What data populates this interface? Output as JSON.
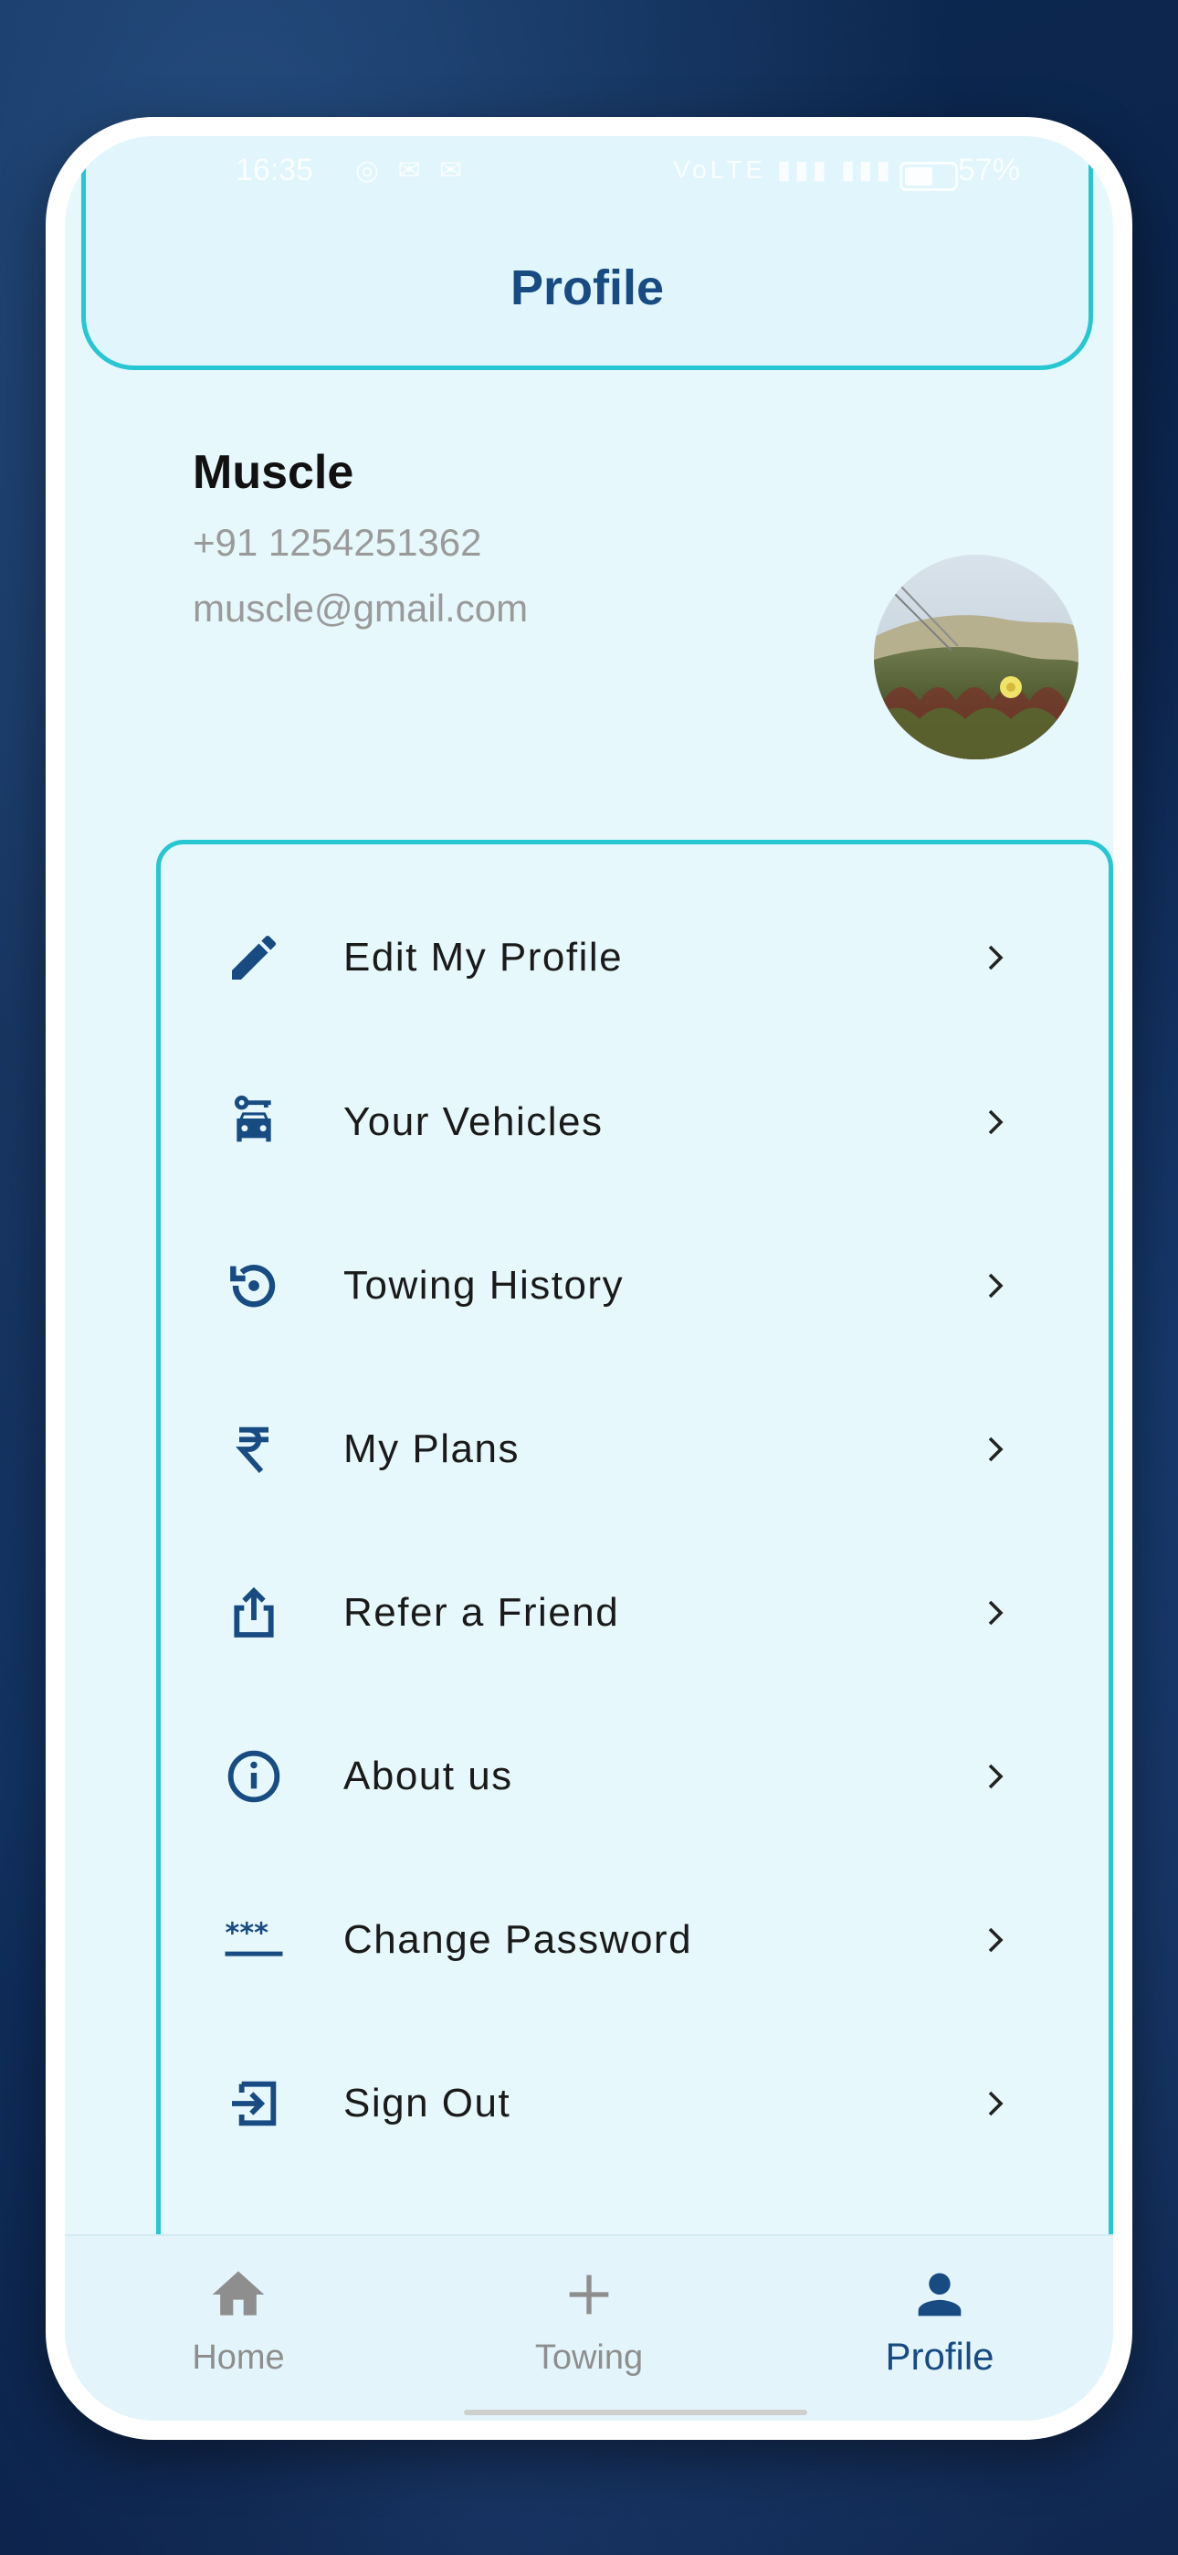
{
  "status_bar": {
    "time": "16:35",
    "left_icons": "◎ ✉ ✉",
    "right_icons": "VoLTE ▮▮▮ ▮▮▮",
    "battery_percent": "57%",
    "battery_level": 0.57
  },
  "header": {
    "title": "Profile"
  },
  "user": {
    "name": "Muscle",
    "phone": "+91 1254251362",
    "email": "muscle@gmail.com"
  },
  "menu": {
    "items": [
      {
        "label": "Edit My Profile",
        "icon": "edit-pencil-icon"
      },
      {
        "label": "Your Vehicles",
        "icon": "car-key-icon"
      },
      {
        "label": "Towing History",
        "icon": "history-icon"
      },
      {
        "label": "My Plans",
        "icon": "rupee-icon"
      },
      {
        "label": "Refer a Friend",
        "icon": "share-icon"
      },
      {
        "label": "About us",
        "icon": "info-icon"
      },
      {
        "label": "Change Password",
        "icon": "password-icon"
      },
      {
        "label": "Sign Out",
        "icon": "sign-out-icon"
      }
    ]
  },
  "bottom_nav": {
    "items": [
      {
        "label": "Home",
        "icon": "home-icon",
        "active": false
      },
      {
        "label": "Towing",
        "icon": "plus-icon",
        "active": false
      },
      {
        "label": "Profile",
        "icon": "person-icon",
        "active": true
      }
    ]
  },
  "colors": {
    "primary": "#174b82",
    "accent_border": "#26c6d2",
    "background": "#e6f8fc",
    "inactive_nav": "#8e8e8e",
    "muted_text": "#9a9a9a"
  }
}
